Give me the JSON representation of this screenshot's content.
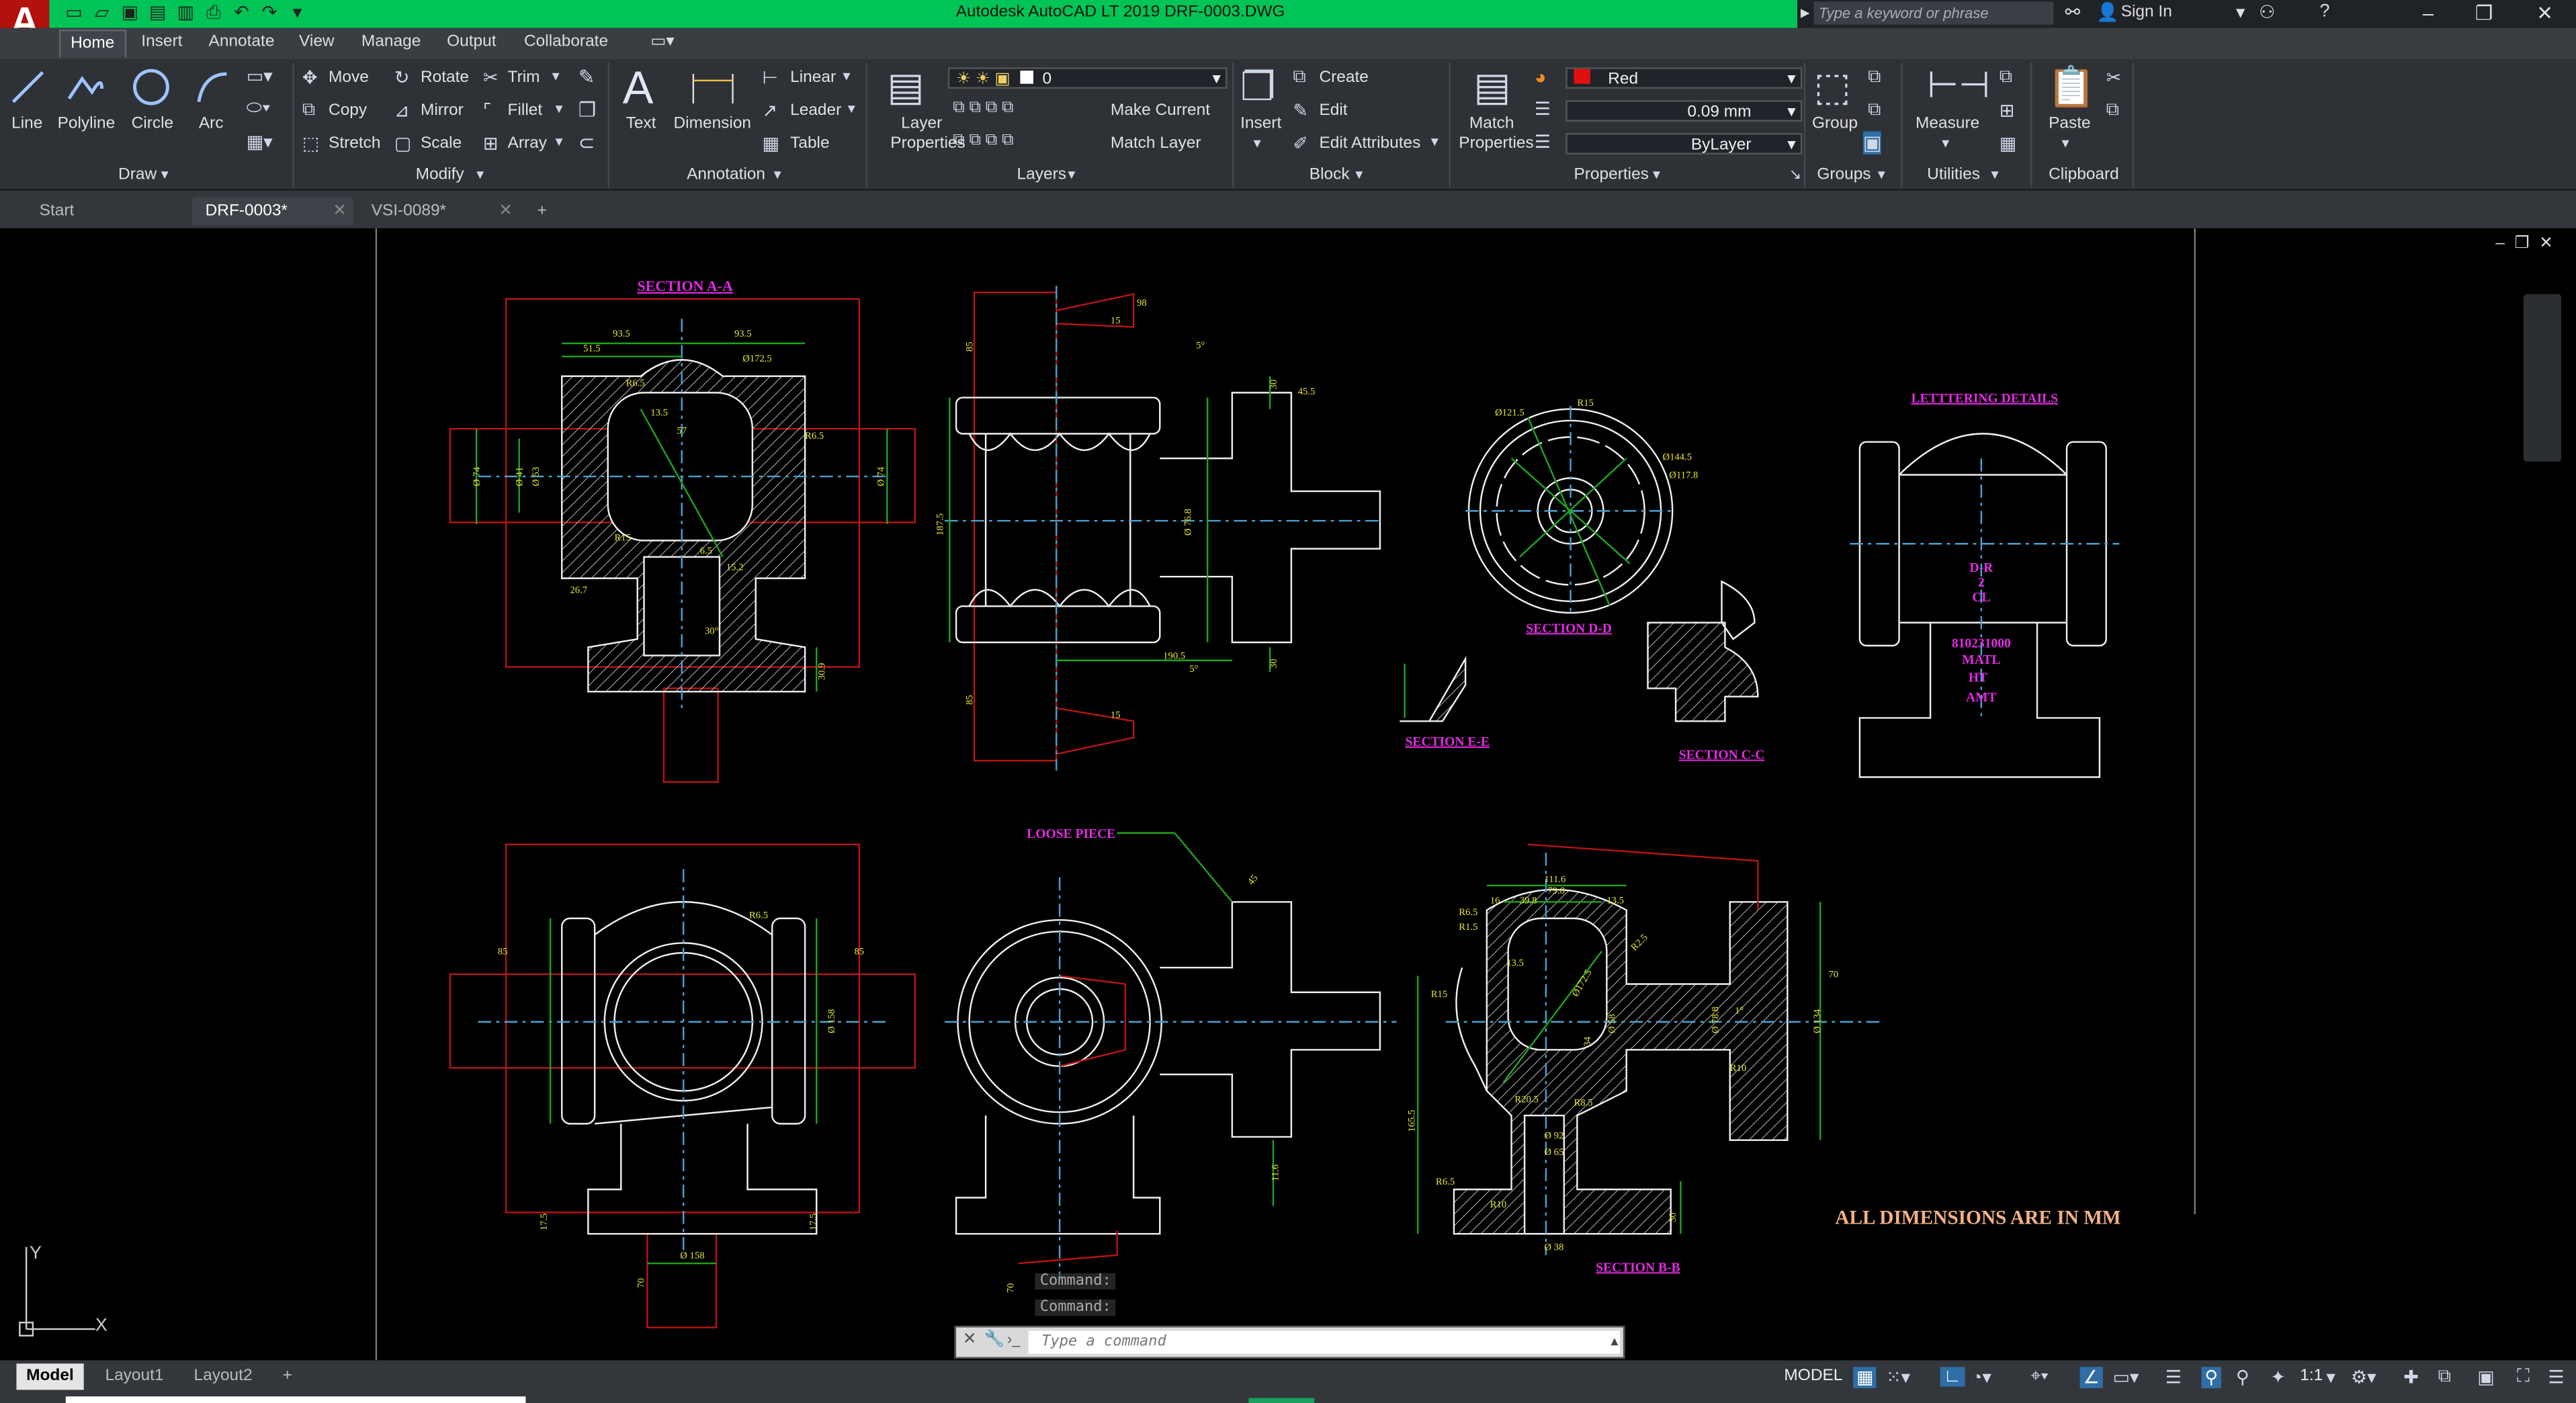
{
  "app": {
    "logo": "A",
    "logo_sub": "LT",
    "title": "Autodesk AutoCAD LT 2019    DRF-0003.DWG"
  },
  "search": {
    "placeholder": "Type a keyword or phrase"
  },
  "signin": "Sign In",
  "ribbon_tabs": [
    "Home",
    "Insert",
    "Annotate",
    "View",
    "Manage",
    "Output",
    "Collaborate"
  ],
  "draw": {
    "line": "Line",
    "polyline": "Polyline",
    "circle": "Circle",
    "arc": "Arc",
    "panel": "Draw"
  },
  "modify": {
    "move": "Move",
    "rotate": "Rotate",
    "trim": "Trim",
    "copy": "Copy",
    "mirror": "Mirror",
    "fillet": "Fillet",
    "stretch": "Stretch",
    "scale": "Scale",
    "array": "Array",
    "panel": "Modify"
  },
  "annotation": {
    "text": "Text",
    "dimension": "Dimension",
    "linear": "Linear",
    "leader": "Leader",
    "table": "Table",
    "panel": "Annotation"
  },
  "layers": {
    "properties": "Layer Properties",
    "current_layer": "0",
    "make_current": "Make Current",
    "match_layer": "Match Layer",
    "panel": "Layers"
  },
  "block": {
    "insert": "Insert",
    "create": "Create",
    "edit": "Edit",
    "edit_attributes": "Edit Attributes",
    "panel": "Block"
  },
  "properties": {
    "match": "Match Properties",
    "color": "Red",
    "color_hex": "#e01010",
    "lineweight": "0.09 mm",
    "linetype": "ByLayer",
    "panel": "Properties"
  },
  "groups": {
    "group": "Group",
    "panel": "Groups"
  },
  "utilities": {
    "measure": "Measure",
    "panel": "Utilities"
  },
  "clipboard": {
    "paste": "Paste",
    "panel": "Clipboard"
  },
  "file_tabs": [
    {
      "label": "Start"
    },
    {
      "label": "DRF-0003*"
    },
    {
      "label": "VSI-0089*"
    }
  ],
  "command": {
    "history1": "Command:",
    "history2": "Command:",
    "placeholder": "Type a command"
  },
  "layouts": [
    "Model",
    "Layout1",
    "Layout2"
  ],
  "status": {
    "model": "MODEL",
    "scale": "1:1"
  },
  "drawing": {
    "section_aa": "SECTION A-A",
    "section_dd": "SECTION D-D",
    "section_ee": "SECTION E-E",
    "section_cc": "SECTION C-C",
    "section_bb": "SECTION B-B",
    "loose_piece": "LOOSE PIECE",
    "lettering_details": "LETTTERING DETAILS",
    "letter1": "D-R",
    "letter2": "2",
    "letter3": "CL",
    "letter4": "810231000",
    "letter5": "MATL",
    "letter6": "HT",
    "letter7": "AMT",
    "note": "ALL DIMENSIONS ARE IN MM",
    "dims": {
      "d93a": "93.5",
      "d93b": "93.5",
      "d51": "51.5",
      "d172": "Ø172.5",
      "r65": "R6.5",
      "r65b": "R6.5",
      "d135": "13.5",
      "d57": "57",
      "d74a": "Ø 74",
      "d41": "Ø 41",
      "d53": "Ø 53",
      "d74b": "Ø 74",
      "r15": "R15",
      "d65": "6.5",
      "d26": "26.7",
      "d30": "30°",
      "d152": "15.2",
      "d309": "30.9",
      "dd121": "Ø121.5",
      "ddr15": "R15",
      "dd144": "Ø144.5",
      "dd117": "Ø117.8",
      "c1": "98",
      "c2": "15",
      "c3": "5°",
      "c4": "30",
      "c5": "45.5",
      "c6": "187.5",
      "c7": "Ø 76.8",
      "c8": "190.5",
      "c9": "5°",
      "c10": "15",
      "c11": "85",
      "c12": "85",
      "c13": "30",
      "b1": "111.6",
      "b2": "79.8",
      "b3": "39.8",
      "b4": "13.5",
      "b5": "R6.5",
      "b6": "R1.5",
      "b7": "R15",
      "b8": "13.5",
      "b9": "Ø172.5",
      "b10": "34",
      "b11": "Ø 58",
      "b12": "Ø 78.8",
      "b13": "Ø 134",
      "b14": "R10",
      "b15": "R20.5",
      "b16": "R8.5",
      "b17": "Ø 92",
      "b18": "Ø 65",
      "b19": "165.5",
      "b20": "R6.5",
      "b21": "R10",
      "b22": "Ø 38",
      "b23": "30",
      "b24": "70",
      "b25": "1°",
      "b26": "R2.5",
      "b27": "16",
      "l1": "85",
      "l2": "85",
      "l3": "R6.5",
      "l4": "Ø 158",
      "l5": "17.5",
      "l6": "17.5",
      "l7": "70",
      "l8": "Ø 158",
      "lp1": "45",
      "lp2": "11.6",
      "lp3": "70"
    }
  }
}
